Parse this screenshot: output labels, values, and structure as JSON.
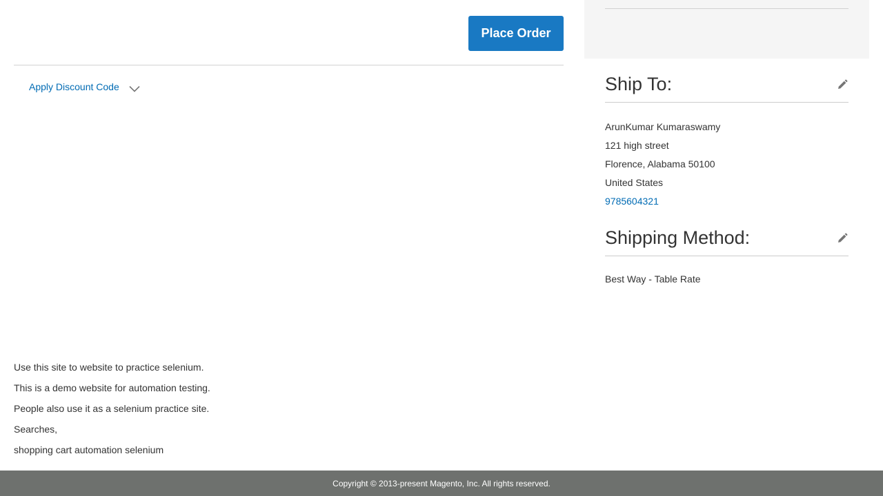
{
  "checkout": {
    "place_order_label": "Place Order",
    "discount_label": "Apply Discount Code"
  },
  "ship_to": {
    "title": "Ship To:",
    "name": "ArunKumar Kumaraswamy",
    "street": "121 high street",
    "city_region_zip": "Florence, Alabama 50100",
    "country": "United States",
    "phone": "9785604321"
  },
  "shipping_method": {
    "title": "Shipping Method:",
    "value": "Best Way - Table Rate"
  },
  "footer": {
    "lines": [
      "Use this site to website to practice selenium.",
      "This is a demo website for automation testing.",
      "People also use it as a selenium practice site.",
      "Searches,",
      "shopping cart automation selenium"
    ],
    "copyright": "Copyright © 2013-present Magento, Inc. All rights reserved."
  },
  "icons": {
    "edit": "pencil-icon",
    "chevron": "chevron-down-icon"
  },
  "colors": {
    "primary_button": "#1979c3",
    "link": "#006bb4",
    "copyright_bar": "#6e716e",
    "sidebar_bg": "#f5f5f5"
  }
}
